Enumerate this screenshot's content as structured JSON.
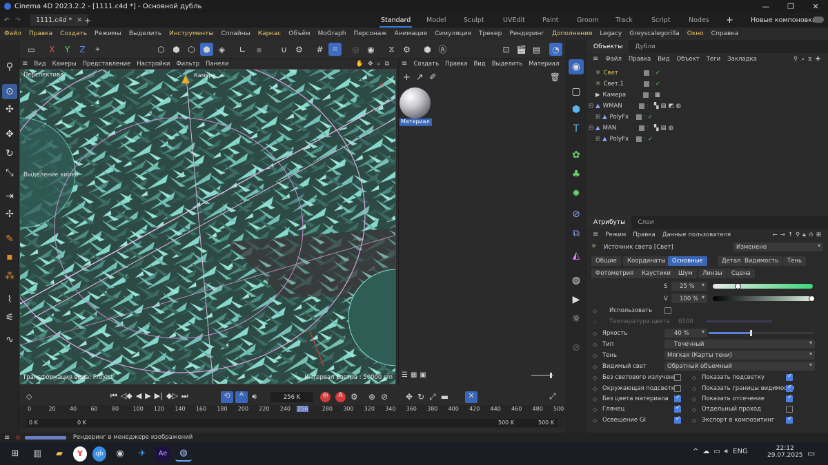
{
  "title": "Cinema 4D 2023.2.2 - [1111.c4d *] - Основной дубль",
  "doc_tab": "1111.c4d *",
  "workspaces": [
    "Standard",
    "Model",
    "Sculpt",
    "UVEdit",
    "Paint",
    "Groom",
    "Track",
    "Script",
    "Nodes"
  ],
  "active_workspace": "Standard",
  "layouts_label": "Новые компоновки",
  "menu": [
    "Файл",
    "Правка",
    "Создать",
    "Режимы",
    "Выделить",
    "Инструменты",
    "Сплайны",
    "Каркас",
    "Объём",
    "MoGraph",
    "Персонаж",
    "Анимация",
    "Симуляция",
    "Трекер",
    "Рендеринг",
    "Дополнения",
    "Legacy",
    "Greyscalegorilla",
    "Окно",
    "Справка"
  ],
  "viewport": {
    "menu": [
      "Вид",
      "Камеры",
      "Представление",
      "Настройки",
      "Фильтр",
      "Панели"
    ],
    "name": "Перспектива",
    "camera_label": "Камера",
    "overlay_left": "Выделение килев",
    "bottom_left": "Трансформация вида: Project",
    "bottom_right": "Интервал растра : 50000 cm",
    "corner_mark": "×"
  },
  "materials": {
    "menu": [
      "Создать",
      "Правка",
      "Вид",
      "Выделить",
      "Материал"
    ],
    "more": ">",
    "items": [
      {
        "label": "Материал"
      }
    ]
  },
  "objects": {
    "tabs": [
      "Объекты",
      "Дубли"
    ],
    "menu": [
      "Файл",
      "Правка",
      "Вид",
      "Объект",
      "Теги",
      "Закладка"
    ],
    "rows": [
      {
        "name": "Свет",
        "selected": true
      },
      {
        "name": "Свет.1"
      },
      {
        "name": "Камера"
      },
      {
        "name": "WMAN"
      },
      {
        "name": "PolyFx"
      },
      {
        "name": "MAN"
      },
      {
        "name": "PolyFx"
      }
    ]
  },
  "attributes": {
    "tabs": [
      "Атрибуты",
      "Слои"
    ],
    "menu": [
      "Режим",
      "Правка",
      "Данные пользователя"
    ],
    "object_label": "Источник света [Свет]",
    "mode_value": "Изменено",
    "tab_row1": [
      "Общие",
      "Координаты",
      "Основные",
      "Детали",
      "Видимость",
      "Тень"
    ],
    "tab_row2": [
      "Фотометрия",
      "Каустики",
      "Шум",
      "Линзы",
      "Сцена"
    ],
    "active_tab": "Основные",
    "s_label": "S",
    "s_value": "25 %",
    "s_fraction": 0.25,
    "v_label": "V",
    "v_value": "100 %",
    "v_fraction": 1.0,
    "use_label": "Использовать",
    "temp_label": "Температура цвета",
    "temp_value": "6500",
    "brightness_label": "Яркость",
    "brightness_value": "40 %",
    "brightness_fraction": 0.4,
    "type_label": "Тип",
    "type_value": "Точечный",
    "shadow_label": "Тень",
    "shadow_value": "Мягкая (Карты тени)",
    "visible_label": "Видимый свет",
    "visible_value": "Обратный объемный",
    "checks_left": [
      {
        "label": "Без светового излучения",
        "on": false
      },
      {
        "label": "Окружающая подсветка",
        "on": false
      },
      {
        "label": "Без цвета материала",
        "on": true
      },
      {
        "label": "Глянец",
        "on": true
      },
      {
        "label": "Освещение GI",
        "on": true
      }
    ],
    "checks_right": [
      {
        "label": "Показать подсветку",
        "on": true
      },
      {
        "label": "Показать границы видимости",
        "on": true
      },
      {
        "label": "Показать отсечение",
        "on": true
      },
      {
        "label": "Отдельный проход",
        "on": false
      },
      {
        "label": "Экспорт в композитинг",
        "on": true
      }
    ]
  },
  "timeline": {
    "frame_value": "256 K",
    "ticks": [
      "0",
      "20",
      "40",
      "60",
      "80",
      "100",
      "120",
      "140",
      "160",
      "180",
      "200",
      "220",
      "240",
      "256",
      "280",
      "300",
      "320",
      "340",
      "360",
      "380",
      "400",
      "420",
      "440",
      "460",
      "480",
      "500"
    ],
    "start_a": "0 K",
    "start_b": "0 K",
    "end_a": "500 K",
    "end_b": "500 K"
  },
  "status": "Рендеринг в менеджере изображений",
  "taskbar": {
    "lang": "ENG",
    "time": "22:12",
    "date": "29.07.2025"
  }
}
